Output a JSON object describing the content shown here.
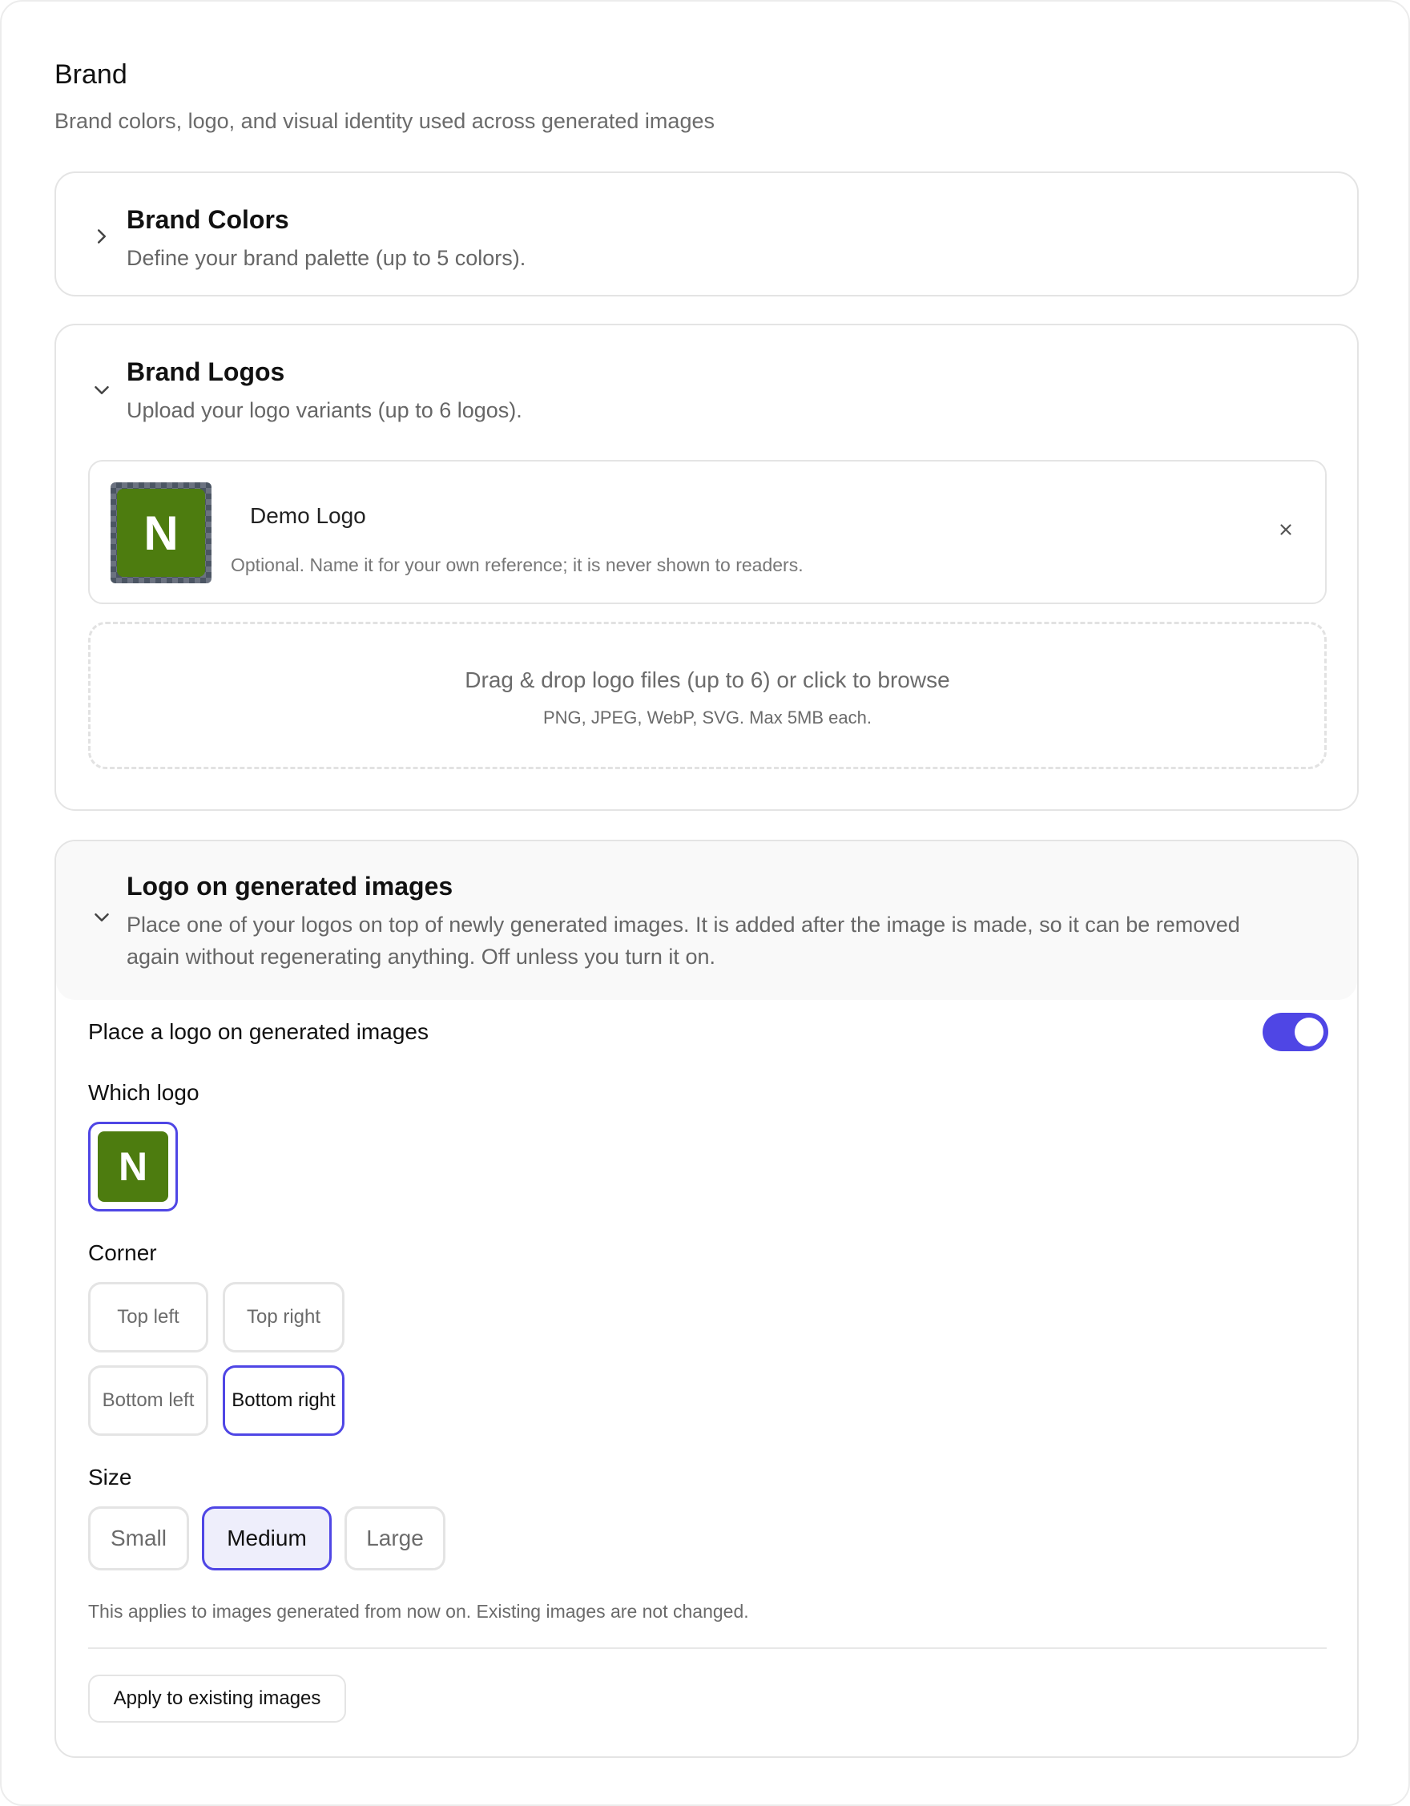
{
  "section": {
    "title": "Brand",
    "subtitle": "Brand colors, logo, and visual identity used across generated images"
  },
  "brand_colors": {
    "title": "Brand Colors",
    "description": "Define your brand palette (up to 5 colors).",
    "expanded": false
  },
  "brand_logos": {
    "title": "Brand Logos",
    "description": "Upload your logo variants (up to 6 logos).",
    "expanded": true,
    "logos": [
      {
        "letter": "N",
        "name": "Demo Logo",
        "hint": "Optional. Name it for your own reference; it is never shown to readers.",
        "color": "#4d7c0f"
      }
    ],
    "dropzone": {
      "main": "Drag & drop logo files (up to 6) or click to browse",
      "sub": "PNG, JPEG, WebP, SVG. Max 5MB each."
    }
  },
  "overlay": {
    "title": "Logo on generated images",
    "description_line1": "Place one of your logos on top of newly generated images. It is added after the image is made, so it can be removed",
    "description_line2": "again without regenerating anything. Off unless you turn it on.",
    "toggle_label": "Place a logo on generated images",
    "toggle_on": true,
    "which_logo_label": "Which logo",
    "selected_logo_letter": "N",
    "corner_label": "Corner",
    "corners": [
      "Top left",
      "Top right",
      "Bottom left",
      "Bottom right"
    ],
    "selected_corner": "Bottom right",
    "size_label": "Size",
    "sizes": [
      "Small",
      "Medium",
      "Large"
    ],
    "selected_size": "Medium",
    "note": "This applies to images generated from now on. Existing images are not changed.",
    "apply_button": "Apply to existing images"
  },
  "colors": {
    "accent": "#4f46e5",
    "logo_green": "#4d7c0f"
  }
}
